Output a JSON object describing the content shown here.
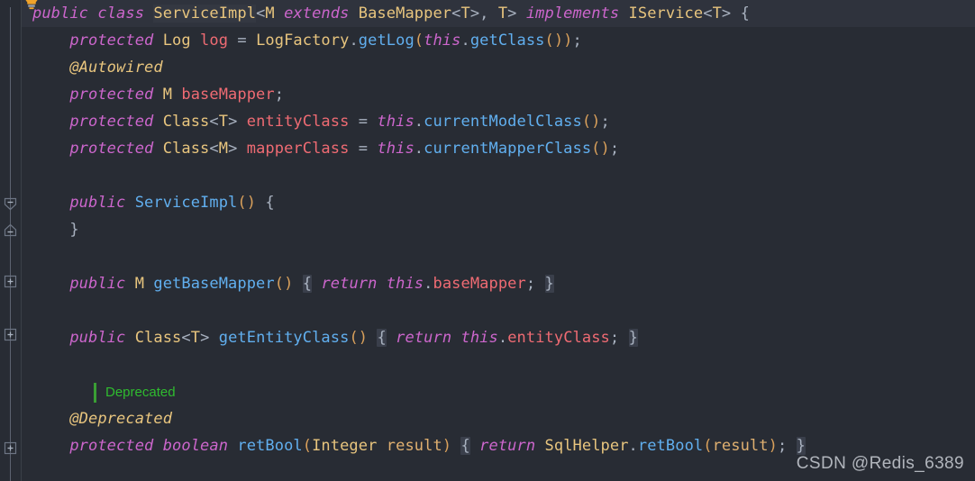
{
  "editor": {
    "theme_name": "darcula-one-dark",
    "background": "#282c34",
    "current_line_background": "#2f333d",
    "gutter_background": "#282c34",
    "colors": {
      "keyword": "#cc66cc",
      "type": "#e8c57e",
      "field": "#ef6b73",
      "method": "#61afef",
      "punctuation": "#a9b2c0",
      "parenthesis": "#d9a05b",
      "annotation": "#e8c57e",
      "parameter": "#e0b070",
      "inlay_hint": "#2fbb2f",
      "brace_highlight_bg": "#3a3f4b",
      "identifier_highlight_bg": "#343842"
    }
  },
  "gutter": {
    "lightbulb_icon": "lightbulb-intention-icon",
    "markers": [
      {
        "icon": "fold-region-start-icon",
        "label": "−"
      },
      {
        "icon": "fold-region-end-icon",
        "label": "−"
      },
      {
        "icon": "fold-collapsed-icon",
        "label": "+"
      },
      {
        "icon": "fold-collapsed-icon",
        "label": "+"
      },
      {
        "icon": "fold-collapsed-icon",
        "label": "+"
      }
    ]
  },
  "code": {
    "line01": {
      "t1": "public ",
      "t2": "class ",
      "t3": "ServiceImpl",
      "t4": "<",
      "t5": "M ",
      "t6": "extends ",
      "t7": "BaseMapper",
      "t8": "<",
      "t9": "T",
      "t10": ">, ",
      "t11": "T",
      "t12": "> ",
      "t13": "implements ",
      "t14": "IService",
      "t15": "<",
      "t16": "T",
      "t17": "> ",
      "t18": "{"
    },
    "line02": {
      "t1": "protected ",
      "t2": "Log ",
      "t3": "log",
      "t4": " = ",
      "t5": "LogFactory",
      "t6": ".",
      "t7": "getLog",
      "t8": "(",
      "t9": "this",
      "t10": ".",
      "t11": "getClass",
      "t12": "())",
      "t13": ";"
    },
    "line03": {
      "t1": "@Autowired"
    },
    "line04": {
      "t1": "protected ",
      "t2": "M ",
      "t3": "baseMapper",
      "t4": ";"
    },
    "line05": {
      "t1": "protected ",
      "t2": "Class",
      "t3": "<",
      "t4": "T",
      "t5": "> ",
      "t6": "entityClass",
      "t7": " = ",
      "t8": "this",
      "t9": ".",
      "t10": "currentModelClass",
      "t11": "()",
      "t12": ";"
    },
    "line06": {
      "t1": "protected ",
      "t2": "Class",
      "t3": "<",
      "t4": "M",
      "t5": "> ",
      "t6": "mapperClass",
      "t7": " = ",
      "t8": "this",
      "t9": ".",
      "t10": "currentMapperClass",
      "t11": "()",
      "t12": ";"
    },
    "line08": {
      "t1": "public ",
      "t2": "ServiceImpl",
      "t3": "()",
      "t4": " ",
      "t5": "{"
    },
    "line09": {
      "t1": "}"
    },
    "line11": {
      "t1": "public ",
      "t2": "M ",
      "t3": "getBaseMapper",
      "t4": "()",
      "t5": " ",
      "t6": "{",
      "t7": " ",
      "t8": "return ",
      "t9": "this",
      "t10": ".",
      "t11": "baseMapper",
      "t12": "; ",
      "t13": "}"
    },
    "line13": {
      "t1": "public ",
      "t2": "Class",
      "t3": "<",
      "t4": "T",
      "t5": "> ",
      "t6": "getEntityClass",
      "t7": "()",
      "t8": " ",
      "t9": "{",
      "t10": " ",
      "t11": "return ",
      "t12": "this",
      "t13": ".",
      "t14": "entityClass",
      "t15": "; ",
      "t16": "}"
    },
    "hint_deprecated": "Deprecated",
    "line16": {
      "t1": "@Deprecated"
    },
    "line17": {
      "t1": "protected ",
      "t2": "boolean ",
      "t3": "retBool",
      "t4": "(",
      "t5": "Integer ",
      "t6": "result",
      "t7": ")",
      "t8": " ",
      "t9": "{",
      "t10": " ",
      "t11": "return ",
      "t12": "SqlHelper",
      "t13": ".",
      "t14": "retBool",
      "t15": "(",
      "t16": "result",
      "t17": ")",
      "t18": "; ",
      "t19": "}"
    }
  },
  "watermark": {
    "text": "CSDN @Redis_6389"
  }
}
